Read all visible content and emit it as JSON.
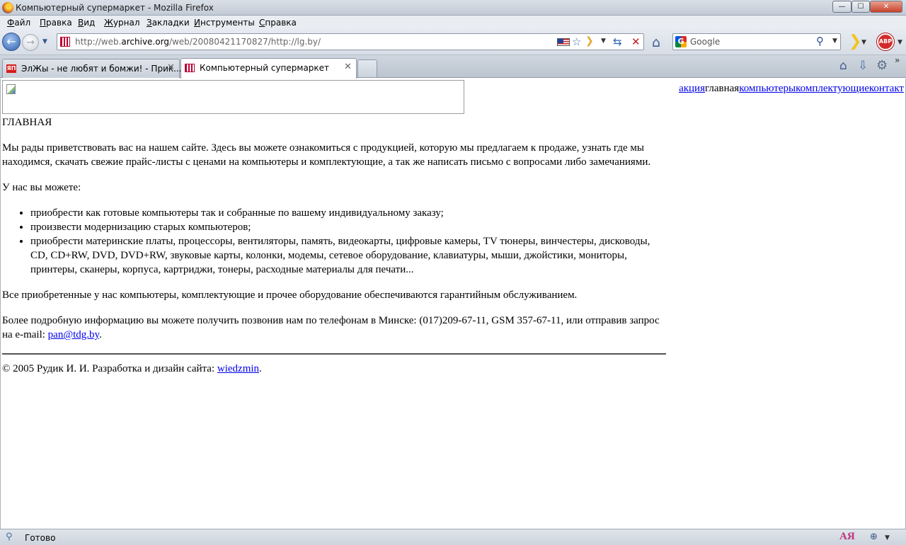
{
  "window": {
    "title": "Компьютерный супермаркет - Mozilla Firefox",
    "minimize": "—",
    "maximize": "☐",
    "close": "✕"
  },
  "menu": {
    "items": [
      "Файл",
      "Правка",
      "Вид",
      "Журнал",
      "Закладки",
      "Инструменты",
      "Справка"
    ]
  },
  "navbar": {
    "url_prefix": "http://web.",
    "url_domain": "archive.org",
    "url_rest": "/web/20080421170827/http://lg.by/",
    "search_placeholder": "Google",
    "abp_label": "ABP"
  },
  "tabs": [
    {
      "label": "ЭлЖы - не любят и бомжи! - Прик...",
      "icon_text": "ЯП",
      "active": false
    },
    {
      "label": "Компьютерный супермаркет",
      "active": true
    }
  ],
  "site": {
    "nav": [
      {
        "label": "акция",
        "link": true
      },
      {
        "label": "главная",
        "link": false
      },
      {
        "label": "компьютеры",
        "link": true
      },
      {
        "label": "комплектующие",
        "link": true
      },
      {
        "label": "контакт",
        "link": true
      }
    ],
    "heading": "ГЛАВНАЯ",
    "intro": "Мы рады приветствовать вас на нашем сайте. Здесь вы можете ознакомиться с продукцией, которую мы предлагаем к продаже, узнать где мы находимся, скачать свежие прайс-листы с ценами на компьютеры и комплектующие, а так же написать письмо с вопросами либо замечаниями.",
    "can_title": "У нас вы можете:",
    "can_list": [
      "приобрести как готовые компьютеры так и собранные по вашему индивидуальному заказу;",
      "произвести модернизацию старых компьютеров;",
      "приобрести материнские платы, процессоры, вентиляторы, память, видеокарты, цифровые камеры, TV тюнеры, винчестеры, дисководы, CD, CD+RW, DVD, DVD+RW, звуковые карты, колонки, модемы, сетевое оборудование, клавиатуры, мыши, джойстики, мониторы, принтеры, сканеры, корпуса, картриджи, тонеры, расходные материалы для печати..."
    ],
    "warranty": "Все приобретенные у нас компьютеры, комплектующие и прочее оборудование обеспечиваются гарантийным обслуживанием.",
    "contact_text": "Более подробную информацию вы можете получить позвонив нам по телефонам в Минске: (017)209-67-11, GSM 357-67-11, или отправив запрос на e-mail: ",
    "email": "pan@tdg.by",
    "period": ".",
    "footer_text": "© 2005 Рудик И. И. Разработка и дизайн сайта: ",
    "designer": "wiedzmin"
  },
  "status": {
    "text": "Готово"
  },
  "colors": {
    "link": "#0000ee",
    "close_button": "#c7422a"
  }
}
